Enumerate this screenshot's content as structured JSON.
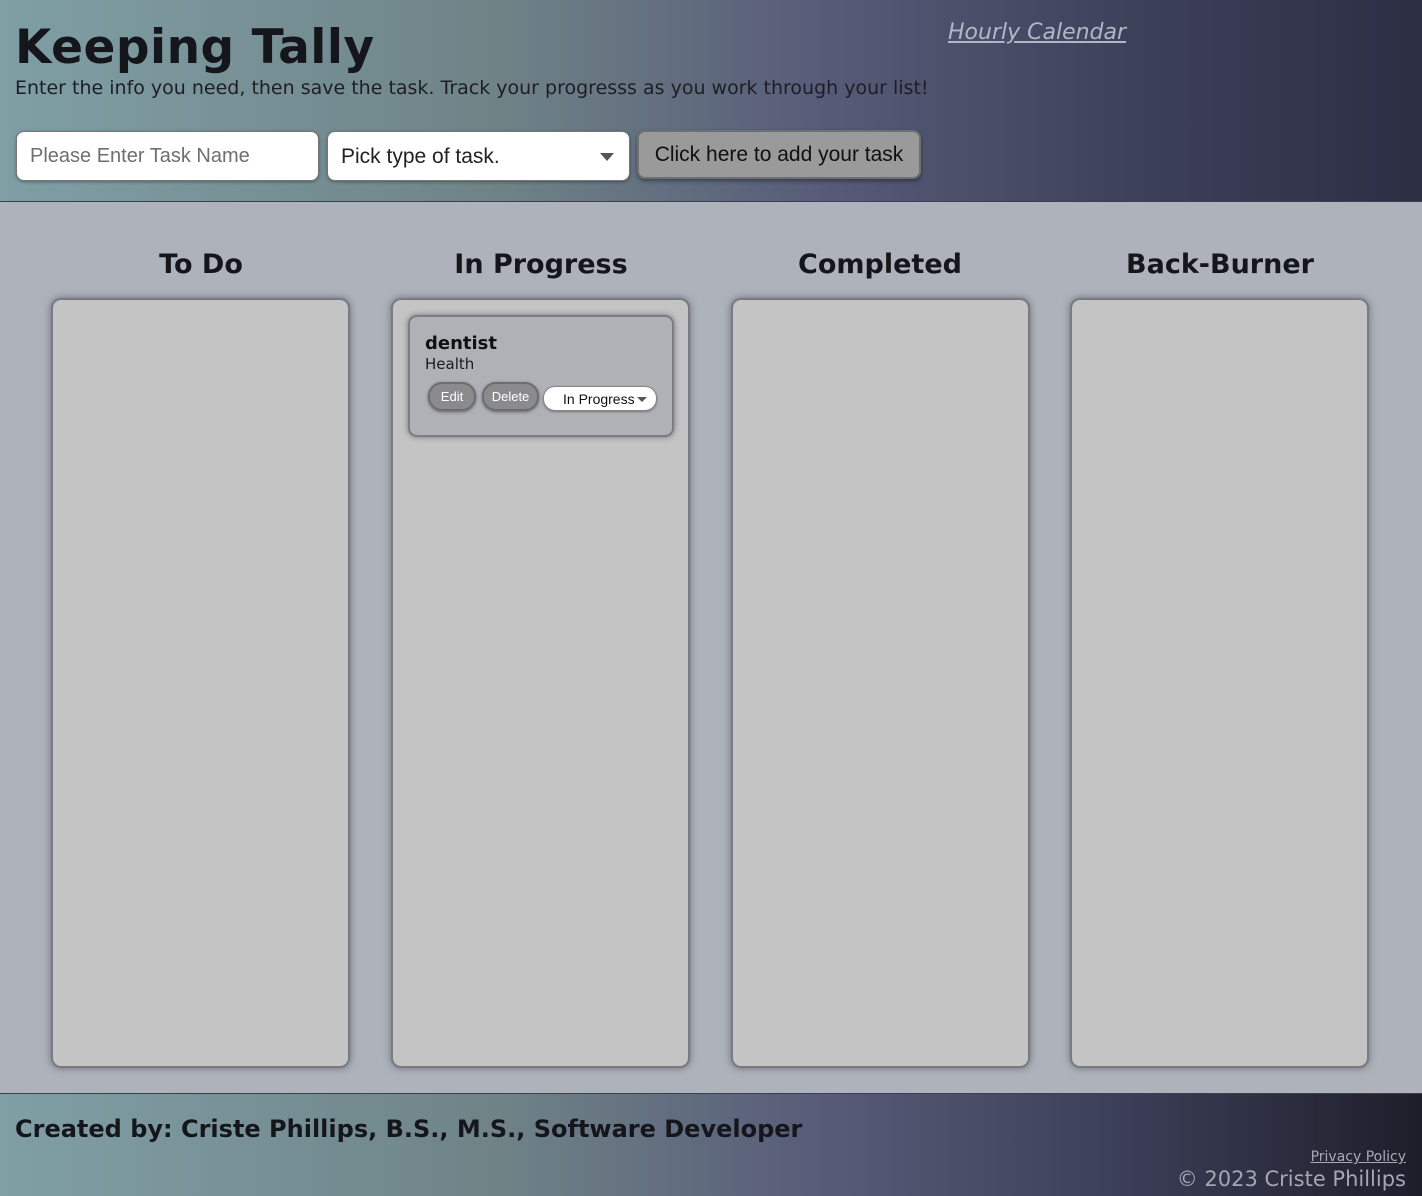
{
  "header": {
    "title": "Keeping Tally",
    "subtitle": "Enter the info you need, then save the task. Track your progresss as you work through your list!",
    "calendar_link": "Hourly Calendar",
    "form": {
      "task_name_placeholder": "Please Enter Task Name",
      "task_type_value": "Pick type of task.",
      "add_button_label": "Click here to add your task"
    }
  },
  "columns": [
    {
      "title": "To Do"
    },
    {
      "title": "In Progress"
    },
    {
      "title": "Completed"
    },
    {
      "title": "Back-Burner"
    }
  ],
  "tasks": [
    {
      "name": "dentist",
      "type": "Health",
      "edit_label": "Edit",
      "delete_label": "Delete",
      "status_value": "In Progress"
    }
  ],
  "footer": {
    "credit": "Created by: Criste Phillips, B.S., M.S., Software Developer",
    "privacy_link": "Privacy Policy",
    "copyright": "© 2023 Criste Phillips"
  },
  "icons": {
    "select_caret": "chevron-down-icon"
  }
}
